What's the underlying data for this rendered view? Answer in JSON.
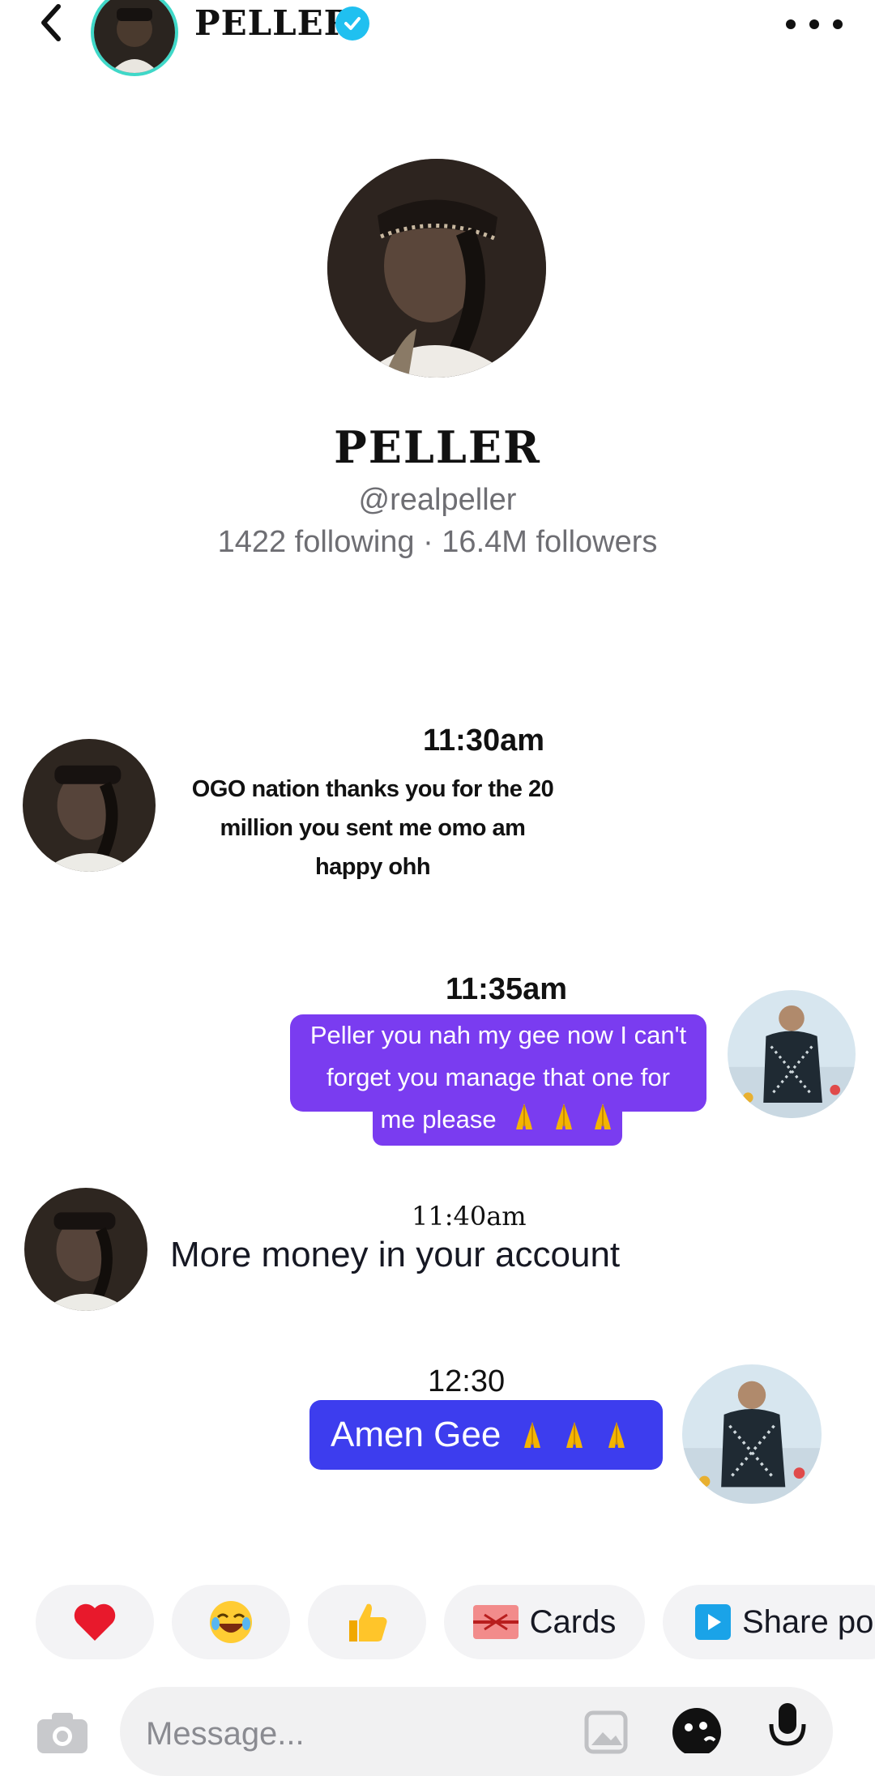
{
  "header": {
    "name": "PELLER",
    "verified": true,
    "back_icon": "chevron-left-icon",
    "more_icon": "more-horizontal-icon"
  },
  "profile": {
    "name": "PELLER",
    "handle": "@realpeller",
    "stats": "1422 following · 16.4M followers"
  },
  "messages": [
    {
      "sender": "them",
      "time": "11:30am",
      "lines": [
        "OGO nation thanks you for the 20",
        "million you sent me omo am",
        "happy ohh"
      ]
    },
    {
      "sender": "me",
      "time": "11:35am",
      "lines": [
        "Peller you nah my gee now I can't",
        "forget you manage that one for",
        "me please"
      ]
    },
    {
      "sender": "them",
      "time": "11:40am",
      "text": "More money in your account"
    },
    {
      "sender": "me",
      "time": "12:30",
      "text": "Amen Gee"
    }
  ],
  "quick_actions": [
    {
      "icon": "heart-emoji-icon"
    },
    {
      "icon": "laughing-emoji-icon"
    },
    {
      "icon": "thumbs-up-emoji-icon"
    },
    {
      "icon": "gift-card-icon",
      "label": "Cards"
    },
    {
      "icon": "share-play-icon",
      "label": "Share po"
    }
  ],
  "composer": {
    "placeholder": "Message...",
    "icons": [
      "camera-icon",
      "image-icon",
      "sticker-icon",
      "microphone-icon"
    ]
  },
  "colors": {
    "verified": "#20c0f0",
    "avatar_ring": "#3fd8c8",
    "my_bubble_purple": "#7a3cf0",
    "my_bubble_blue": "#3d3dee"
  }
}
